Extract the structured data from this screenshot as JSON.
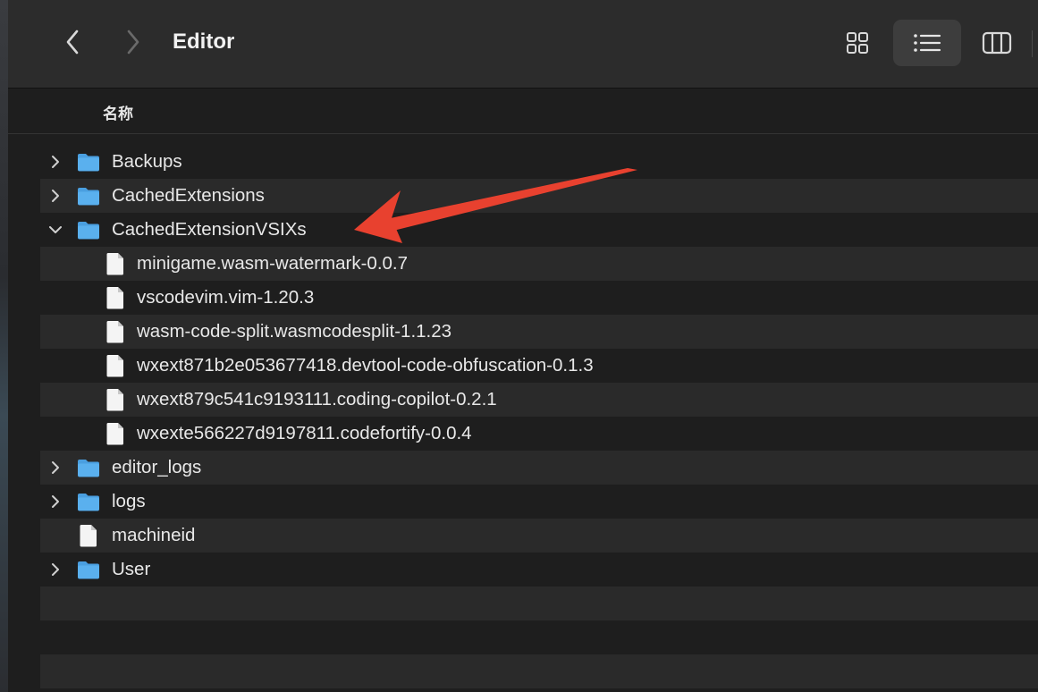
{
  "window": {
    "title": "Editor"
  },
  "toolbar": {
    "back_icon": "chevron-left-icon",
    "forward_icon": "chevron-right-icon",
    "view_modes": [
      "icon-view-icon",
      "list-view-icon",
      "column-view-icon"
    ],
    "active_view": "list"
  },
  "column_header": {
    "name": "名称"
  },
  "items": [
    {
      "label": "Backups",
      "type": "folder",
      "level": 0,
      "expanded": false
    },
    {
      "label": "CachedExtensions",
      "type": "folder",
      "level": 0,
      "expanded": false
    },
    {
      "label": "CachedExtensionVSIXs",
      "type": "folder",
      "level": 0,
      "expanded": true
    },
    {
      "label": "minigame.wasm-watermark-0.0.7",
      "type": "file",
      "level": 1
    },
    {
      "label": "vscodevim.vim-1.20.3",
      "type": "file",
      "level": 1
    },
    {
      "label": "wasm-code-split.wasmcodesplit-1.1.23",
      "type": "file",
      "level": 1
    },
    {
      "label": "wxext871b2e053677418.devtool-code-obfuscation-0.1.3",
      "type": "file",
      "level": 1
    },
    {
      "label": "wxext879c541c9193111.coding-copilot-0.2.1",
      "type": "file",
      "level": 1
    },
    {
      "label": "wxexte566227d9197811.codefortify-0.0.4",
      "type": "file",
      "level": 1
    },
    {
      "label": "editor_logs",
      "type": "folder",
      "level": 0,
      "expanded": false
    },
    {
      "label": "logs",
      "type": "folder",
      "level": 0,
      "expanded": false
    },
    {
      "label": "machineid",
      "type": "file",
      "level": 0
    },
    {
      "label": "User",
      "type": "folder",
      "level": 0,
      "expanded": false
    }
  ],
  "annotation": {
    "arrow_color": "#e8412f",
    "points_to": "CachedExtensionVSIXs"
  },
  "colors": {
    "folder": "#5ab0ee",
    "toolbar_bg": "#2c2c2c",
    "window_bg": "#1e1e1e",
    "row_alt": "#2a2a2a"
  }
}
